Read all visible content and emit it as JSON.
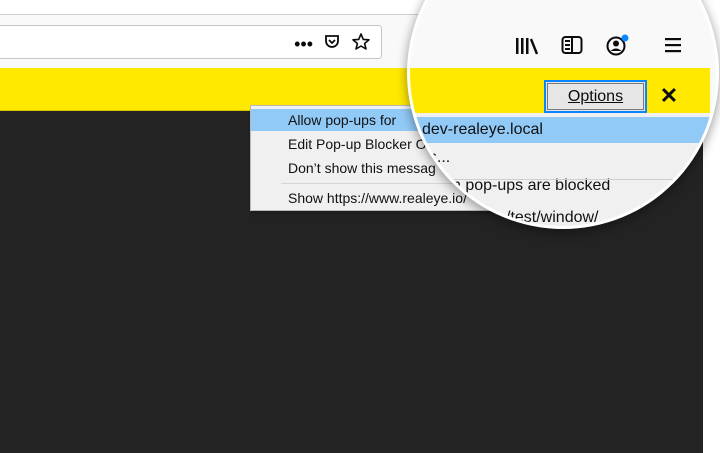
{
  "urlbar": {
    "more_label": "•••",
    "pocket_icon": "pocket-icon",
    "bookmark_icon": "star-icon"
  },
  "toolbar": {
    "library_icon": "library-icon",
    "sidebar_icon": "sidebar-icon",
    "account_icon": "account-icon",
    "menu_icon": "hamburger-menu-icon",
    "account_dot_color": "#0a84ff"
  },
  "notification": {
    "options_label": "Options",
    "close_label": "✕",
    "bar_color": "#ffe900"
  },
  "popup_menu": {
    "items": [
      {
        "label": "Allow pop-ups for",
        "selected": true
      },
      {
        "label": "Edit Pop-up Blocker O"
      },
      {
        "label": "Don’t show this messag"
      },
      {
        "label": "Show https://www.realeye.io/"
      }
    ]
  },
  "lens": {
    "rows": [
      {
        "label": "dev-realeye.local"
      },
      {
        "label": "ns..."
      },
      {
        "label": "n pop-ups are blocked"
      },
      {
        "label": "/test/window/"
      }
    ]
  },
  "content": {
    "bg_color": "#232323"
  }
}
